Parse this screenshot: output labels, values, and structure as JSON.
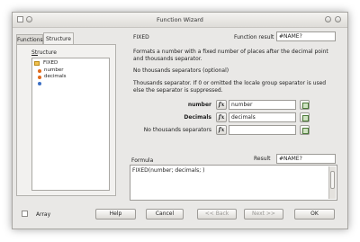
{
  "window": {
    "title": "Function Wizard"
  },
  "tabs": [
    {
      "label": "Functions",
      "active": false
    },
    {
      "label": "Structure",
      "active": true
    }
  ],
  "structure": {
    "label": "Structure",
    "root": "FIXED",
    "children": [
      "number",
      "decimals"
    ]
  },
  "function": {
    "name": "FIXED",
    "result_label": "Function result",
    "result_value": "#NAME?",
    "description": "Formats a number with a fixed number of places after the decimal point and thousands separator.",
    "arg_title": "No thousands separators (optional)",
    "arg_description": "Thousands separator. If 0 or omitted the locale group separator is used else the separator is suppressed."
  },
  "arguments": [
    {
      "label": "number",
      "value": "number",
      "bold": true
    },
    {
      "label": "Decimals",
      "value": "decimals",
      "bold": true
    },
    {
      "label": "No thousands separators",
      "value": "",
      "bold": false
    }
  ],
  "formula": {
    "label": "Formula",
    "result_label": "Result",
    "result_value": "#NAME?",
    "text": "FIXED(number; decimals; )"
  },
  "footer": {
    "array_label": "Array",
    "help": "Help",
    "cancel": "Cancel",
    "back": "<< Back",
    "next": "Next >>",
    "ok": "OK"
  },
  "colors": {
    "accent_orange": "#e06a1c",
    "accent_blue": "#3c6fc4"
  }
}
